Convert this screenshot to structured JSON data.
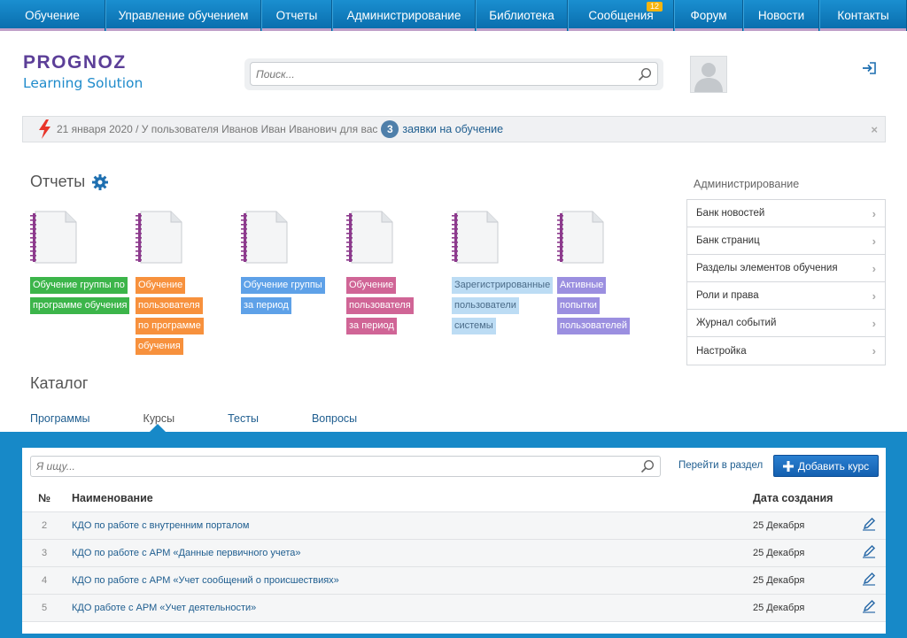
{
  "nav": {
    "items": [
      {
        "label": "Обучение",
        "w": 119
      },
      {
        "label": "Управление обучением",
        "w": 176
      },
      {
        "label": "Отчеты",
        "w": 80
      },
      {
        "label": "Администрирование",
        "w": 162
      },
      {
        "label": "Библиотека",
        "w": 104
      },
      {
        "label": "Сообщения",
        "w": 120
      },
      {
        "label": "Форум",
        "w": 78
      },
      {
        "label": "Новости",
        "w": 86
      },
      {
        "label": "Контакты",
        "w": 99
      }
    ],
    "messages_badge": "12"
  },
  "logo": {
    "line1": "PROGNOZ",
    "line2": "Learning Solution"
  },
  "search": {
    "placeholder": "Поиск..."
  },
  "notice": {
    "text": "21 января 2020 / У пользователя Иванов Иван Иванович для вас",
    "count": "3",
    "link": "заявки на обучение",
    "close": "×"
  },
  "reports": {
    "title": "Отчеты",
    "items": [
      {
        "lines": [
          "Обучение группы по",
          "программе обучения"
        ],
        "color": "#3cb54a"
      },
      {
        "lines": [
          "Обучение",
          "пользователя",
          "по программе",
          "обучения"
        ],
        "color": "#f7913d"
      },
      {
        "lines": [
          "Обучение группы",
          "за период"
        ],
        "color": "#5ea1e8"
      },
      {
        "lines": [
          "Обучение",
          "пользователя",
          "за период"
        ],
        "color": "#d06596"
      },
      {
        "lines": [
          "Зарегистрированные",
          "пользователи",
          "системы"
        ],
        "color": "#bcdcf4",
        "text_color": "#4a6b88"
      },
      {
        "lines": [
          "Активные",
          "попытки",
          "пользователей"
        ],
        "color": "#9b8fe0"
      }
    ]
  },
  "admin": {
    "title": "Администрирование",
    "items": [
      "Банк новостей",
      "Банк страниц",
      "Разделы элементов обучения",
      "Роли и права",
      "Журнал событий",
      "Настройка"
    ]
  },
  "catalog": {
    "title": "Каталог",
    "tabs": [
      "Программы",
      "Курсы",
      "Тесты",
      "Вопросы"
    ],
    "active_tab": "Курсы",
    "search_placeholder": "Я ищу...",
    "goto_link": "Перейти в раздел",
    "add_button": "Добавить курс",
    "columns": {
      "num": "№",
      "name": "Наименование",
      "date": "Дата создания"
    },
    "rows": [
      {
        "num": "2",
        "name": "КДО по работе с внутренним порталом",
        "date": "25 Декабря"
      },
      {
        "num": "3",
        "name": "КДО по работе с АРМ «Данные первичного учета»",
        "date": "25 Декабря"
      },
      {
        "num": "4",
        "name": "КДО по работе с АРМ «Учет сообщений о происшествиях»",
        "date": "25 Декабря"
      },
      {
        "num": "5",
        "name": "КДО работе с АРМ «Учет деятельности»",
        "date": "25 Декабря"
      }
    ]
  }
}
